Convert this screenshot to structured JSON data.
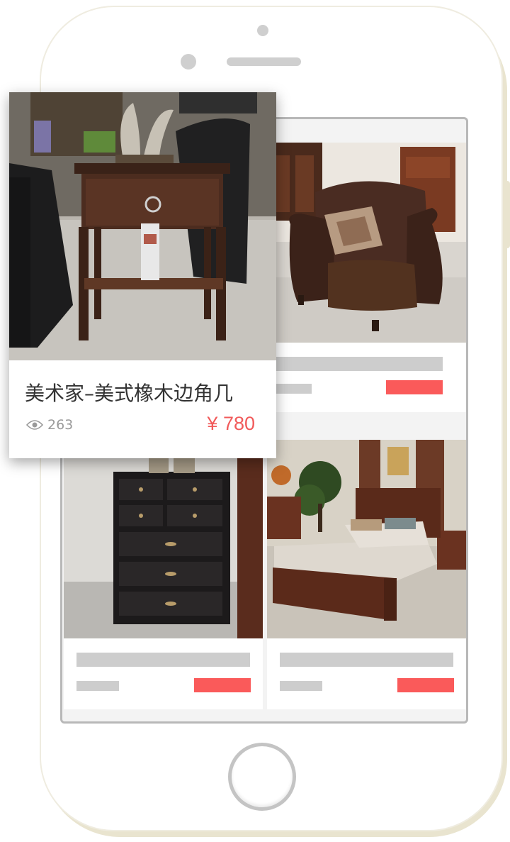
{
  "product": {
    "title": "美术家–美式橡木边角几",
    "views": "263",
    "price": "¥ 780"
  },
  "icons": {
    "views": "eye-icon"
  },
  "colors": {
    "price": "#f15a5a",
    "placeholder_bar": "#cdcdcd",
    "placeholder_price": "#fa5a5a",
    "phone_trim": "#e9e4cf"
  },
  "grid_items": [
    {
      "image": "leather armchair"
    },
    {
      "image": "black chest of drawers"
    },
    {
      "image": "wooden bed"
    }
  ]
}
